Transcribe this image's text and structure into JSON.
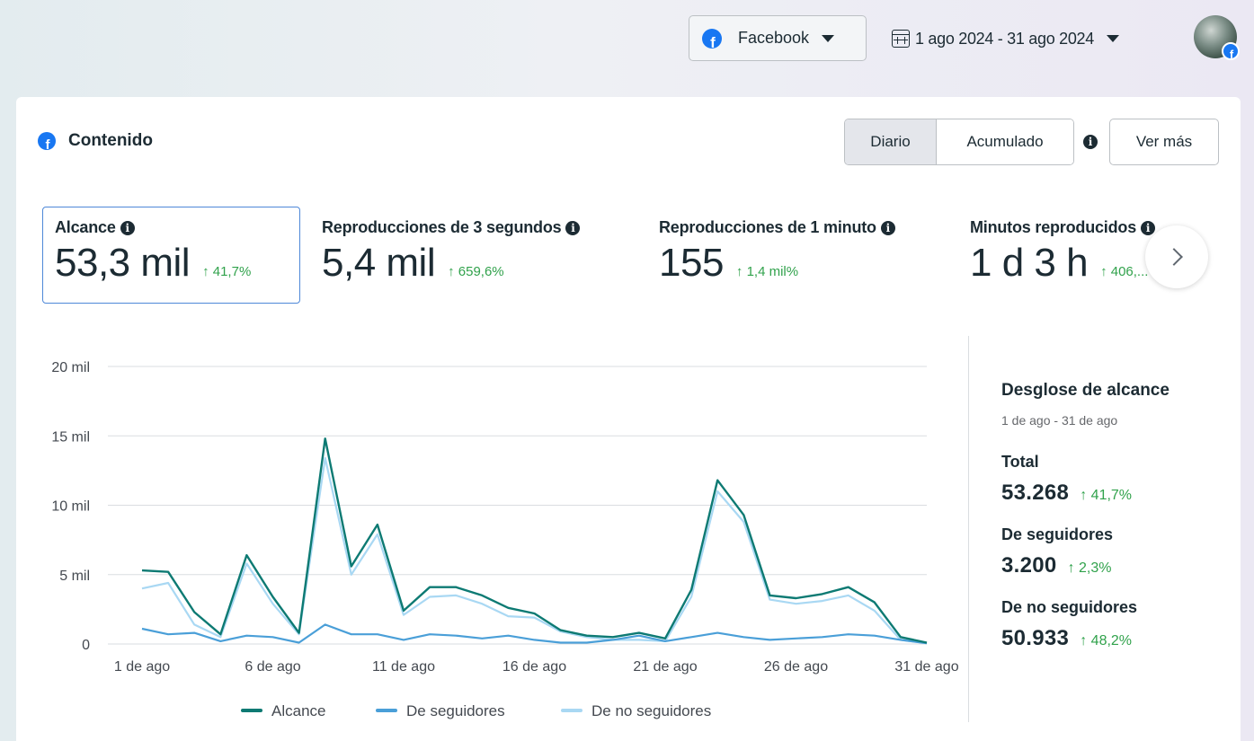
{
  "header": {
    "platform": "Facebook",
    "date_range": "1 ago 2024 - 31 ago 2024"
  },
  "card": {
    "title": "Contenido",
    "toggle": {
      "active": "Diario",
      "inactive": "Acumulado"
    },
    "ver_mas": "Ver más"
  },
  "metrics": [
    {
      "label": "Alcance",
      "value": "53,3 mil",
      "delta": "↑ 41,7%"
    },
    {
      "label": "Reproducciones de 3 segundos",
      "value": "5,4 mil",
      "delta": "↑ 659,6%"
    },
    {
      "label": "Reproducciones de 1 minuto",
      "value": "155",
      "delta": "↑ 1,4 mil%"
    },
    {
      "label": "Minutos reproducidos",
      "value": "1 d 3 h",
      "delta": "↑ 406,..."
    }
  ],
  "breakdown": {
    "title": "Desglose de alcance",
    "range": "1 de ago - 31 de ago",
    "items": [
      {
        "label": "Total",
        "value": "53.268",
        "delta": "↑ 41,7%"
      },
      {
        "label": "De seguidores",
        "value": "3.200",
        "delta": "↑ 2,3%"
      },
      {
        "label": "De no seguidores",
        "value": "50.933",
        "delta": "↑ 48,2%"
      }
    ]
  },
  "colors": {
    "alcance": "#0d7a73",
    "seguidores": "#4a9fd8",
    "no_seguidores": "#a9d8f3",
    "positive": "#31a24c",
    "brand": "#1877f2"
  },
  "chart_data": {
    "type": "line",
    "x": [
      "1 de ago",
      "2 de ago",
      "3 de ago",
      "4 de ago",
      "5 de ago",
      "6 de ago",
      "7 de ago",
      "8 de ago",
      "9 de ago",
      "10 de ago",
      "11 de ago",
      "12 de ago",
      "13 de ago",
      "14 de ago",
      "15 de ago",
      "16 de ago",
      "17 de ago",
      "18 de ago",
      "19 de ago",
      "20 de ago",
      "21 de ago",
      "22 de ago",
      "23 de ago",
      "24 de ago",
      "25 de ago",
      "26 de ago",
      "27 de ago",
      "28 de ago",
      "29 de ago",
      "30 de ago",
      "31 de ago"
    ],
    "xticks": [
      "1 de ago",
      "6 de ago",
      "11 de ago",
      "16 de ago",
      "21 de ago",
      "26 de ago",
      "31 de ago"
    ],
    "yticks": [
      "0",
      "5 mil",
      "10 mil",
      "15 mil",
      "20 mil"
    ],
    "ylim": [
      0,
      20000
    ],
    "grid": true,
    "legend_position": "bottom",
    "series": [
      {
        "name": "Alcance",
        "values": [
          5300,
          5200,
          2300,
          700,
          6400,
          3400,
          800,
          14800,
          5600,
          8600,
          2400,
          4100,
          4100,
          3500,
          2600,
          2200,
          1000,
          600,
          500,
          800,
          400,
          3900,
          11800,
          9300,
          3500,
          3300,
          3600,
          4100,
          3000,
          500,
          100
        ]
      },
      {
        "name": "De seguidores",
        "values": [
          1100,
          700,
          800,
          200,
          600,
          500,
          100,
          1400,
          700,
          700,
          300,
          700,
          600,
          400,
          600,
          300,
          100,
          100,
          300,
          600,
          200,
          500,
          800,
          500,
          300,
          400,
          500,
          700,
          600,
          300,
          50
        ]
      },
      {
        "name": "De no seguidores",
        "values": [
          4000,
          4400,
          1400,
          500,
          5800,
          2900,
          700,
          13400,
          5000,
          7900,
          2100,
          3400,
          3500,
          2900,
          2000,
          1900,
          900,
          500,
          300,
          300,
          200,
          3400,
          11000,
          8800,
          3200,
          2900,
          3100,
          3500,
          2400,
          300,
          50
        ]
      }
    ]
  }
}
